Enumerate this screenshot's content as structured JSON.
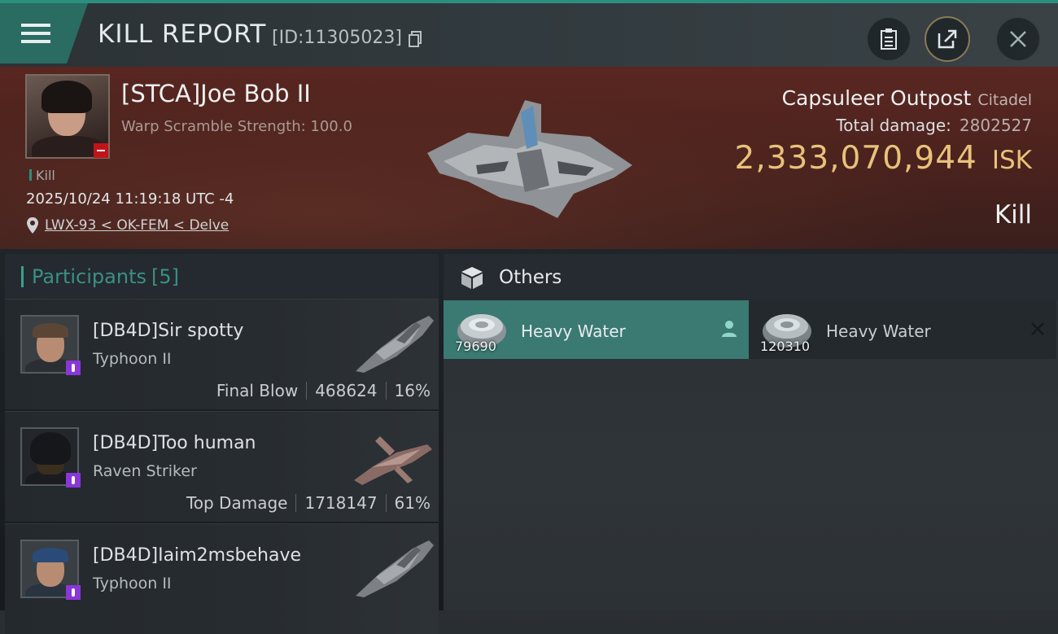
{
  "header": {
    "title": "KILL REPORT",
    "report_id": "[ID:11305023]"
  },
  "victim": {
    "name": "[STCA]Joe Bob II",
    "subtitle": "Warp Scramble Strength: 100.0",
    "kill_tag": "Kill",
    "timestamp": "2025/10/24 11:19:18 UTC -4",
    "location": "LWX-93 < OK-FEM < Delve"
  },
  "target": {
    "name": "Capsuleer Outpost",
    "class": "Citadel",
    "total_damage_label": "Total damage:",
    "total_damage_value": "2802527",
    "isk_value": "2,333,070,944",
    "isk_unit": "ISK",
    "outcome": "Kill"
  },
  "participants": {
    "label": "Participants",
    "count": "[5]",
    "rows": [
      {
        "name": "[DB4D]Sir spotty",
        "ship": "Typhoon II",
        "role": "Final Blow",
        "damage": "468624",
        "percent": "16%"
      },
      {
        "name": "[DB4D]Too human",
        "ship": "Raven Striker",
        "role": "Top Damage",
        "damage": "1718147",
        "percent": "61%"
      },
      {
        "name": "[DB4D]Iaim2msbehave",
        "ship": "Typhoon II"
      }
    ]
  },
  "others": {
    "label": "Others",
    "items": [
      {
        "name": "Heavy Water",
        "quantity": "79690"
      },
      {
        "name": "Heavy Water",
        "quantity": "120310"
      }
    ]
  },
  "colors": {
    "accent": "#2b8f7e",
    "isk": "#e8c27a",
    "selected_item": "#3a7a72",
    "badge_red": "#c0141a",
    "badge_purple": "#8a36d8"
  }
}
